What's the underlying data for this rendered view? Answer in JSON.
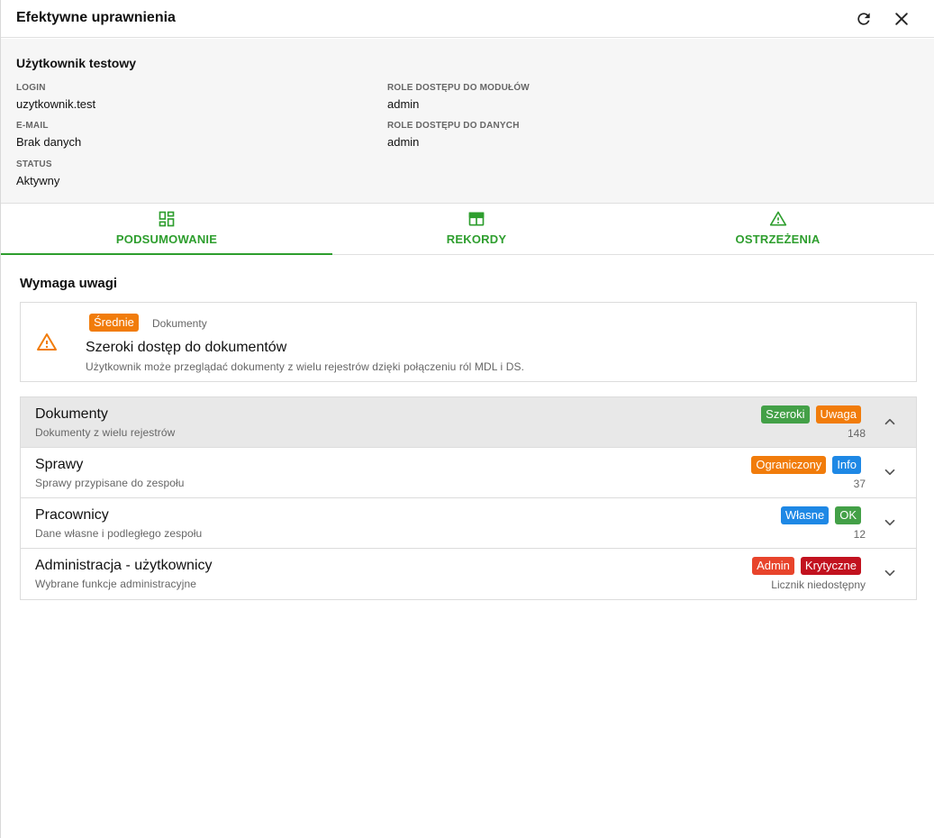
{
  "header": {
    "title": "Efektywne uprawnienia"
  },
  "user": {
    "name": "Użytkownik testowy",
    "fields": {
      "login": {
        "label": "LOGIN",
        "value": "uzytkownik.test"
      },
      "email": {
        "label": "E-MAIL",
        "value": "Brak danych"
      },
      "status": {
        "label": "STATUS",
        "value": "Aktywny"
      },
      "module_roles": {
        "label": "ROLE DOSTĘPU DO MODUŁÓW",
        "value": "admin"
      },
      "data_roles": {
        "label": "ROLE DOSTĘPU DO DANYCH",
        "value": "admin"
      }
    }
  },
  "tabs": [
    {
      "label": "PODSUMOWANIE",
      "icon": "dashboard-icon",
      "active": true
    },
    {
      "label": "REKORDY",
      "icon": "table-icon",
      "active": false
    },
    {
      "label": "OSTRZEŻENIA",
      "icon": "warning-icon",
      "active": false
    }
  ],
  "summary": {
    "section_title": "Wymaga uwagi",
    "warning": {
      "severity": "Średnie",
      "category": "Dokumenty",
      "title": "Szeroki dostęp do dokumentów",
      "description": "Użytkownik może przeglądać dokumenty z wielu rejestrów dzięki połączeniu ról MDL i DS."
    },
    "records": [
      {
        "title": "Dokumenty",
        "subtitle": "Dokumenty z wielu rejestrów",
        "badges": [
          {
            "label": "Szeroki",
            "color": "#43a047"
          },
          {
            "label": "Uwaga",
            "color": "#f17c0b"
          }
        ],
        "count": "148",
        "expanded": true
      },
      {
        "title": "Sprawy",
        "subtitle": "Sprawy przypisane do zespołu",
        "badges": [
          {
            "label": "Ograniczony",
            "color": "#f17c0b"
          },
          {
            "label": "Info",
            "color": "#1e88e5"
          }
        ],
        "count": "37",
        "expanded": false
      },
      {
        "title": "Pracownicy",
        "subtitle": "Dane własne i podległego zespołu",
        "badges": [
          {
            "label": "Własne",
            "color": "#1e88e5"
          },
          {
            "label": "OK",
            "color": "#43a047"
          }
        ],
        "count": "12",
        "expanded": false
      },
      {
        "title": "Administracja - użytkownicy",
        "subtitle": "Wybrane funkcje administracyjne",
        "badges": [
          {
            "label": "Admin",
            "color": "#e8442b"
          },
          {
            "label": "Krytyczne",
            "color": "#c2121f"
          }
        ],
        "count": "Licznik niedostępny",
        "expanded": false
      }
    ]
  },
  "colors": {
    "accent": "#2e9e2e",
    "warning": "#f17c0b"
  }
}
